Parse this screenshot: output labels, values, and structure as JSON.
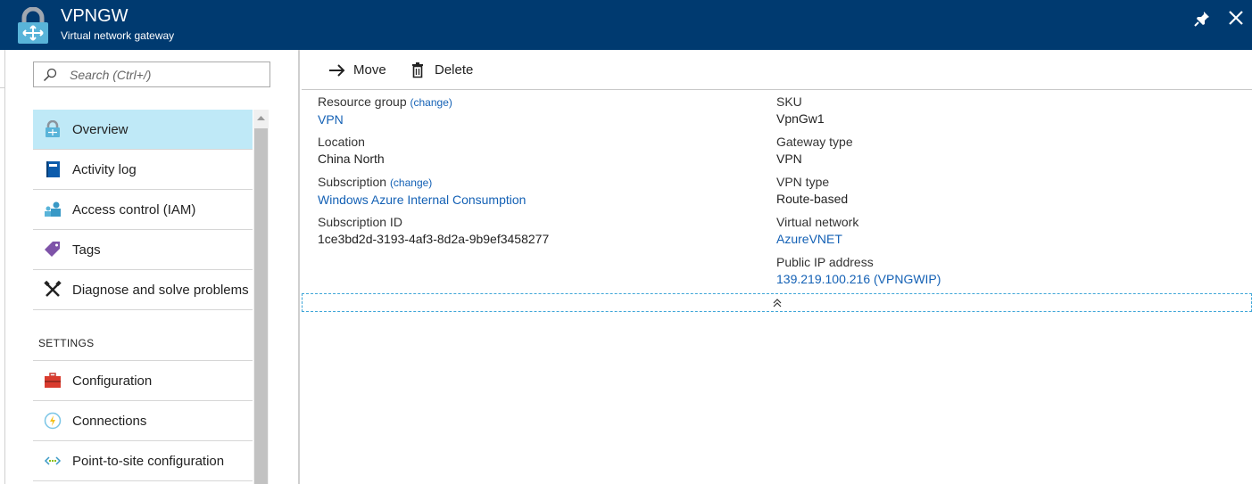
{
  "header": {
    "title": "VPNGW",
    "subtitle": "Virtual network gateway"
  },
  "sidebar": {
    "search_placeholder": "Search (Ctrl+/)",
    "items": [
      {
        "label": "Overview",
        "icon": "vpn-gateway-icon",
        "active": true
      },
      {
        "label": "Activity log",
        "icon": "activity-log-icon"
      },
      {
        "label": "Access control (IAM)",
        "icon": "access-control-icon"
      },
      {
        "label": "Tags",
        "icon": "tag-icon"
      },
      {
        "label": "Diagnose and solve problems",
        "icon": "wrench-icon"
      }
    ],
    "section_label": "SETTINGS",
    "settings_items": [
      {
        "label": "Configuration",
        "icon": "toolbox-icon"
      },
      {
        "label": "Connections",
        "icon": "connections-icon"
      },
      {
        "label": "Point-to-site configuration",
        "icon": "point-to-site-icon"
      }
    ]
  },
  "toolbar": {
    "move_label": "Move",
    "delete_label": "Delete"
  },
  "essentials": {
    "change_label": "(change)",
    "left": [
      {
        "key": "Resource group",
        "value": "VPN",
        "link": true,
        "change": true
      },
      {
        "key": "Location",
        "value": "China North",
        "link": false,
        "change": false
      },
      {
        "key": "Subscription",
        "value": "Windows Azure Internal Consumption",
        "link": true,
        "change": true
      },
      {
        "key": "Subscription ID",
        "value": "1ce3bd2d-3193-4af3-8d2a-9b9ef3458277",
        "link": false,
        "change": false
      }
    ],
    "right": [
      {
        "key": "SKU",
        "value": "VpnGw1",
        "link": false
      },
      {
        "key": "Gateway type",
        "value": "VPN",
        "link": false
      },
      {
        "key": "VPN type",
        "value": "Route-based",
        "link": false
      },
      {
        "key": "Virtual network",
        "value": "AzureVNET",
        "link": true
      },
      {
        "key": "Public IP address",
        "value": "139.219.100.216 (VPNGWIP)",
        "link": true
      }
    ]
  },
  "colors": {
    "header_bg": "#003a70",
    "active_item_bg": "#bfe9f7",
    "link": "#1461b5"
  }
}
